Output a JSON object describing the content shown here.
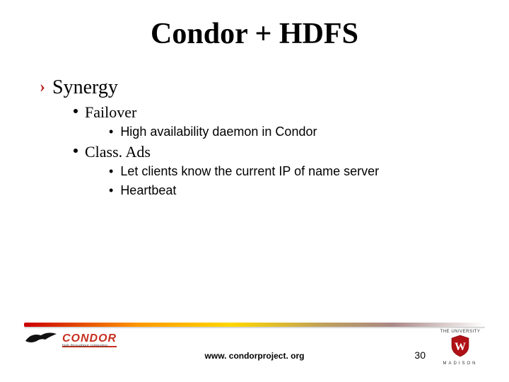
{
  "title": "Condor + HDFS",
  "l1": "Synergy",
  "l2a": "Failover",
  "l3a1": "High availability daemon in Condor",
  "l2b": "Class. Ads",
  "l3b1": "Let clients know the current IP of  name server",
  "l3b2": "Heartbeat",
  "footer": {
    "url": "www. condorproject. org",
    "page": "30",
    "condor_brand": "CONDOR",
    "condor_tag": "high throughput computing",
    "wisc_top": "THE UNIVERSITY",
    "wisc_mid_letter": "W",
    "wisc_bot": "MADISON"
  }
}
